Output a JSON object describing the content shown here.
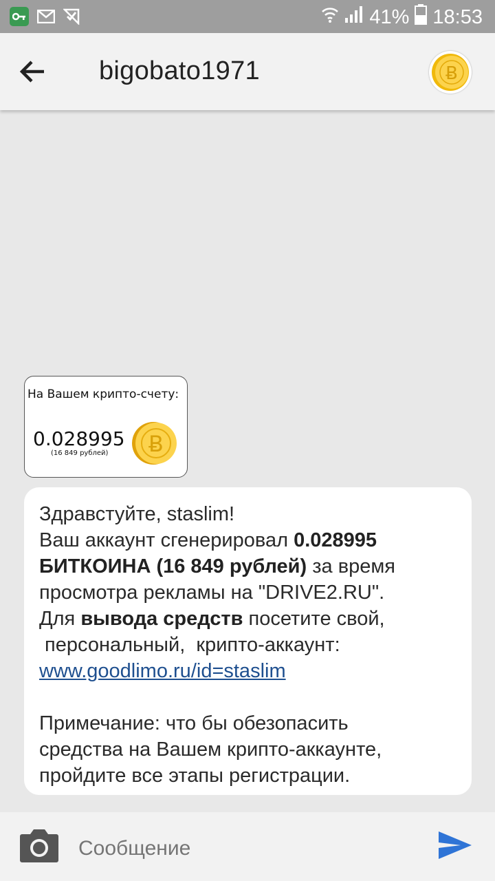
{
  "status_bar": {
    "battery": "41%",
    "time": "18:53"
  },
  "header": {
    "contact_name": "bigobato1971"
  },
  "image_message": {
    "caption": "На Вашем крипто-счету:",
    "amount": "0.028995",
    "rubles": "(16 849 рублей)"
  },
  "text_message": {
    "line1": "Здравстуйте,  staslim!",
    "line2_prefix": "Ваш аккаунт сгенерировал ",
    "line2_bold": "0.028995",
    "line3_bold": "БИТКОИНА (16 849 рублей)",
    "line3_suffix": " за время",
    "line4": "просмотра рекламы на \"DRIVE2.RU\".",
    "line5_prefix": "Для ",
    "line5_bold": "вывода средств",
    "line5_suffix": " посетите свой,",
    "line6": " персональный,  крипто-аккаунт:",
    "link": "www.goodlimo.ru/id=staslim",
    "note1": "Примечание: что бы обезопасить",
    "note2": "средства на Вашем крипто-аккаунте,",
    "note3": "пройдите все этапы регистрации."
  },
  "compose": {
    "placeholder": "Сообщение"
  },
  "colors": {
    "status_bar": "#9e9e9e",
    "app_bar": "#f2f2f2",
    "background": "#e8e8e8",
    "link": "#1e4f8f",
    "send": "#2f74d6",
    "coin": "#f5c42a"
  },
  "icons": [
    "key-icon",
    "mail-icon",
    "check-icon",
    "wifi-icon",
    "signal-icon",
    "battery-icon",
    "back-arrow-icon",
    "bitcoin-coin-icon",
    "camera-icon",
    "send-icon"
  ]
}
